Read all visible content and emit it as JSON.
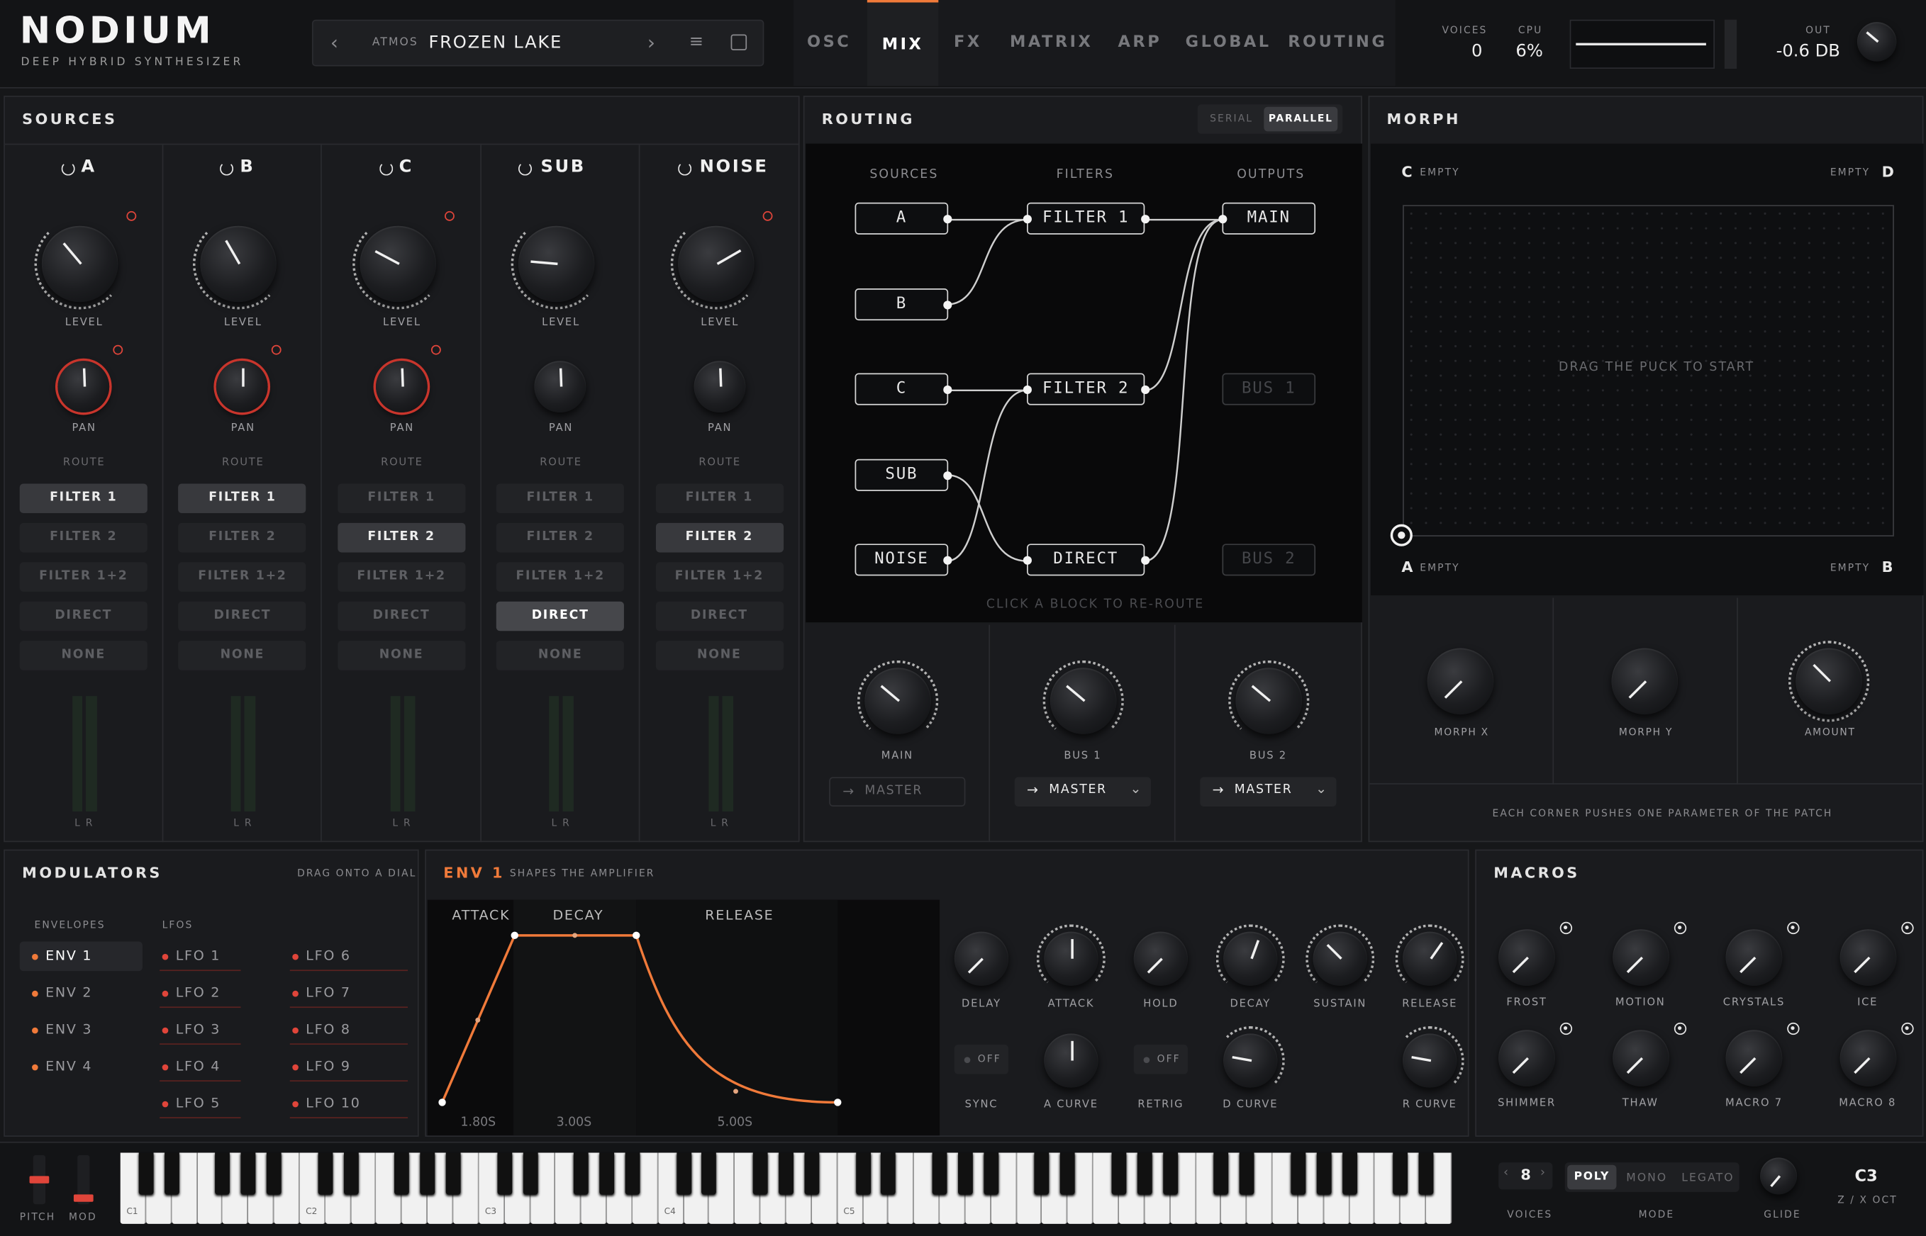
{
  "brand": {
    "logo": "NODIUM",
    "tagline": "DEEP HYBRID SYNTHESIZER"
  },
  "preset": {
    "category": "ATMOS",
    "name": "FROZEN LAKE"
  },
  "tabs": [
    "OSC",
    "MIX",
    "FX",
    "MATRIX",
    "ARP",
    "GLOBAL",
    "ROUTING"
  ],
  "active_tab": "MIX",
  "stats": {
    "voices_label": "VOICES",
    "voices": "0",
    "cpu_label": "CPU",
    "cpu": "6%",
    "out_label": "OUT",
    "out": "-0.6 DB"
  },
  "sources": {
    "title": "SOURCES",
    "channels": [
      {
        "name": "A",
        "level": "LEVEL",
        "pan": "PAN",
        "route": "ROUTE",
        "selected": "FILTER 1"
      },
      {
        "name": "B",
        "level": "LEVEL",
        "pan": "PAN",
        "route": "ROUTE",
        "selected": "FILTER 1"
      },
      {
        "name": "C",
        "level": "LEVEL",
        "pan": "PAN",
        "route": "ROUTE",
        "selected": "FILTER 2"
      },
      {
        "name": "SUB",
        "level": "LEVEL",
        "pan": "PAN",
        "route": "ROUTE",
        "selected": "DIRECT"
      },
      {
        "name": "NOISE",
        "level": "LEVEL",
        "pan": "PAN",
        "route": "ROUTE",
        "selected": "FILTER 2"
      }
    ],
    "route_options": [
      "FILTER 1",
      "FILTER 2",
      "FILTER 1+2",
      "DIRECT",
      "NONE"
    ],
    "meter_label": "L R"
  },
  "routing": {
    "title": "ROUTING",
    "mode_serial": "SERIAL",
    "mode_parallel": "PARALLEL",
    "col_sources": "SOURCES",
    "col_filters": "FILTERS",
    "col_outputs": "OUTPUTS",
    "sources": [
      "A",
      "B",
      "C",
      "SUB",
      "NOISE"
    ],
    "filters": [
      "FILTER 1",
      "FILTER 2",
      "DIRECT"
    ],
    "outputs": [
      "MAIN",
      "BUS 1",
      "BUS 2"
    ],
    "hint": "CLICK A BLOCK TO RE-ROUTE",
    "sends": [
      {
        "label": "MAIN",
        "dest": "MASTER"
      },
      {
        "label": "BUS 1",
        "dest": "MASTER"
      },
      {
        "label": "BUS 2",
        "dest": "MASTER"
      }
    ]
  },
  "morph": {
    "title": "MORPH",
    "c": "C",
    "d": "D",
    "a": "A",
    "b": "B",
    "empty": "EMPTY",
    "hint": "DRAG THE PUCK TO START",
    "knobs": [
      "MORPH X",
      "MORPH Y",
      "AMOUNT"
    ],
    "footer": "EACH CORNER PUSHES ONE PARAMETER OF THE PATCH"
  },
  "modulators": {
    "title": "MODULATORS",
    "hint": "DRAG ONTO A DIAL",
    "envelopes_label": "ENVELOPES",
    "lfos_label": "LFOS",
    "envelopes": [
      "ENV 1",
      "ENV 2",
      "ENV 3",
      "ENV 4"
    ],
    "lfos_a": [
      "LFO 1",
      "LFO 2",
      "LFO 3",
      "LFO 4",
      "LFO 5"
    ],
    "lfos_b": [
      "LFO 6",
      "LFO 7",
      "LFO 8",
      "LFO 9",
      "LFO 10"
    ]
  },
  "env": {
    "title": "ENV 1",
    "subtitle": "SHAPES THE AMPLIFIER",
    "stage_attack": "ATTACK",
    "stage_decay": "DECAY",
    "stage_release": "RELEASE",
    "t_attack": "1.80S",
    "t_decay": "3.00S",
    "t_release": "5.00S",
    "knobs_row1": [
      "DELAY",
      "ATTACK",
      "HOLD",
      "DECAY",
      "SUSTAIN",
      "RELEASE"
    ],
    "sync": "SYNC",
    "retrig": "RETRIG",
    "off": "OFF",
    "a_curve": "A CURVE",
    "d_curve": "D CURVE",
    "r_curve": "R CURVE"
  },
  "macros": {
    "title": "MACROS",
    "items": [
      "FROST",
      "MOTION",
      "CRYSTALS",
      "ICE",
      "SHIMMER",
      "THAW",
      "MACRO 7",
      "MACRO 8"
    ]
  },
  "keyboard": {
    "octaves": [
      "C1",
      "C2",
      "C3",
      "C4",
      "C5"
    ],
    "pitch": "PITCH",
    "mod": "MOD"
  },
  "footer": {
    "voices": "8",
    "voices_label": "VOICES",
    "mode_label": "MODE",
    "modes": [
      "POLY",
      "MONO",
      "LEGATO"
    ],
    "glide": "GLIDE",
    "octave": "C3",
    "octave_hint": "Z / X OCT"
  },
  "colors": {
    "accent": "#f07a3a",
    "red": "#e0453a",
    "bg": "#161719"
  }
}
